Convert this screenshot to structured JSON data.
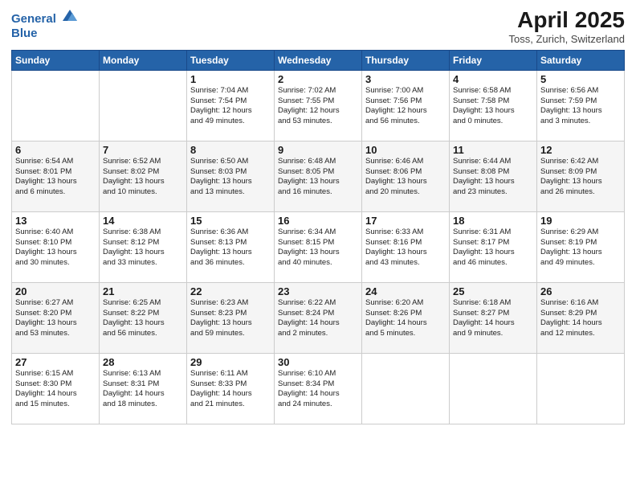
{
  "header": {
    "logo_line1": "General",
    "logo_line2": "Blue",
    "month_year": "April 2025",
    "location": "Toss, Zurich, Switzerland"
  },
  "weekdays": [
    "Sunday",
    "Monday",
    "Tuesday",
    "Wednesday",
    "Thursday",
    "Friday",
    "Saturday"
  ],
  "weeks": [
    [
      {
        "day": "",
        "detail": ""
      },
      {
        "day": "",
        "detail": ""
      },
      {
        "day": "1",
        "detail": "Sunrise: 7:04 AM\nSunset: 7:54 PM\nDaylight: 12 hours\nand 49 minutes."
      },
      {
        "day": "2",
        "detail": "Sunrise: 7:02 AM\nSunset: 7:55 PM\nDaylight: 12 hours\nand 53 minutes."
      },
      {
        "day": "3",
        "detail": "Sunrise: 7:00 AM\nSunset: 7:56 PM\nDaylight: 12 hours\nand 56 minutes."
      },
      {
        "day": "4",
        "detail": "Sunrise: 6:58 AM\nSunset: 7:58 PM\nDaylight: 13 hours\nand 0 minutes."
      },
      {
        "day": "5",
        "detail": "Sunrise: 6:56 AM\nSunset: 7:59 PM\nDaylight: 13 hours\nand 3 minutes."
      }
    ],
    [
      {
        "day": "6",
        "detail": "Sunrise: 6:54 AM\nSunset: 8:01 PM\nDaylight: 13 hours\nand 6 minutes."
      },
      {
        "day": "7",
        "detail": "Sunrise: 6:52 AM\nSunset: 8:02 PM\nDaylight: 13 hours\nand 10 minutes."
      },
      {
        "day": "8",
        "detail": "Sunrise: 6:50 AM\nSunset: 8:03 PM\nDaylight: 13 hours\nand 13 minutes."
      },
      {
        "day": "9",
        "detail": "Sunrise: 6:48 AM\nSunset: 8:05 PM\nDaylight: 13 hours\nand 16 minutes."
      },
      {
        "day": "10",
        "detail": "Sunrise: 6:46 AM\nSunset: 8:06 PM\nDaylight: 13 hours\nand 20 minutes."
      },
      {
        "day": "11",
        "detail": "Sunrise: 6:44 AM\nSunset: 8:08 PM\nDaylight: 13 hours\nand 23 minutes."
      },
      {
        "day": "12",
        "detail": "Sunrise: 6:42 AM\nSunset: 8:09 PM\nDaylight: 13 hours\nand 26 minutes."
      }
    ],
    [
      {
        "day": "13",
        "detail": "Sunrise: 6:40 AM\nSunset: 8:10 PM\nDaylight: 13 hours\nand 30 minutes."
      },
      {
        "day": "14",
        "detail": "Sunrise: 6:38 AM\nSunset: 8:12 PM\nDaylight: 13 hours\nand 33 minutes."
      },
      {
        "day": "15",
        "detail": "Sunrise: 6:36 AM\nSunset: 8:13 PM\nDaylight: 13 hours\nand 36 minutes."
      },
      {
        "day": "16",
        "detail": "Sunrise: 6:34 AM\nSunset: 8:15 PM\nDaylight: 13 hours\nand 40 minutes."
      },
      {
        "day": "17",
        "detail": "Sunrise: 6:33 AM\nSunset: 8:16 PM\nDaylight: 13 hours\nand 43 minutes."
      },
      {
        "day": "18",
        "detail": "Sunrise: 6:31 AM\nSunset: 8:17 PM\nDaylight: 13 hours\nand 46 minutes."
      },
      {
        "day": "19",
        "detail": "Sunrise: 6:29 AM\nSunset: 8:19 PM\nDaylight: 13 hours\nand 49 minutes."
      }
    ],
    [
      {
        "day": "20",
        "detail": "Sunrise: 6:27 AM\nSunset: 8:20 PM\nDaylight: 13 hours\nand 53 minutes."
      },
      {
        "day": "21",
        "detail": "Sunrise: 6:25 AM\nSunset: 8:22 PM\nDaylight: 13 hours\nand 56 minutes."
      },
      {
        "day": "22",
        "detail": "Sunrise: 6:23 AM\nSunset: 8:23 PM\nDaylight: 13 hours\nand 59 minutes."
      },
      {
        "day": "23",
        "detail": "Sunrise: 6:22 AM\nSunset: 8:24 PM\nDaylight: 14 hours\nand 2 minutes."
      },
      {
        "day": "24",
        "detail": "Sunrise: 6:20 AM\nSunset: 8:26 PM\nDaylight: 14 hours\nand 5 minutes."
      },
      {
        "day": "25",
        "detail": "Sunrise: 6:18 AM\nSunset: 8:27 PM\nDaylight: 14 hours\nand 9 minutes."
      },
      {
        "day": "26",
        "detail": "Sunrise: 6:16 AM\nSunset: 8:29 PM\nDaylight: 14 hours\nand 12 minutes."
      }
    ],
    [
      {
        "day": "27",
        "detail": "Sunrise: 6:15 AM\nSunset: 8:30 PM\nDaylight: 14 hours\nand 15 minutes."
      },
      {
        "day": "28",
        "detail": "Sunrise: 6:13 AM\nSunset: 8:31 PM\nDaylight: 14 hours\nand 18 minutes."
      },
      {
        "day": "29",
        "detail": "Sunrise: 6:11 AM\nSunset: 8:33 PM\nDaylight: 14 hours\nand 21 minutes."
      },
      {
        "day": "30",
        "detail": "Sunrise: 6:10 AM\nSunset: 8:34 PM\nDaylight: 14 hours\nand 24 minutes."
      },
      {
        "day": "",
        "detail": ""
      },
      {
        "day": "",
        "detail": ""
      },
      {
        "day": "",
        "detail": ""
      }
    ]
  ]
}
